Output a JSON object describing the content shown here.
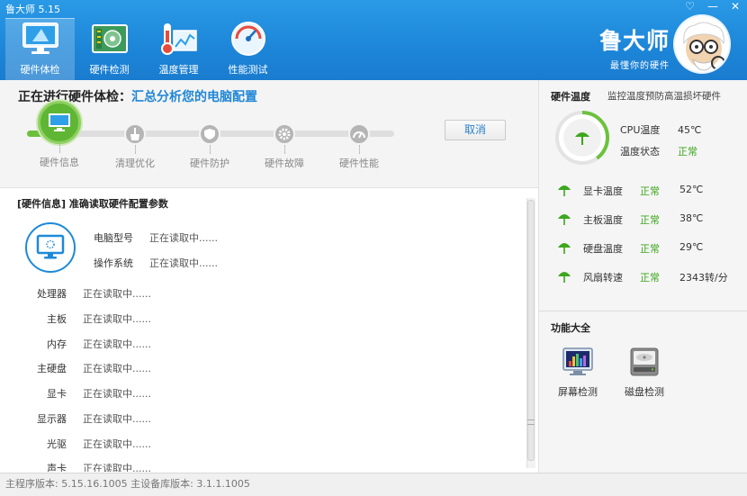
{
  "window": {
    "title": "鲁大师 5.15",
    "controls": [
      "♡",
      "—",
      "✕"
    ]
  },
  "nav": [
    {
      "label": "硬件体检",
      "icon": "monitor-icon",
      "active": true
    },
    {
      "label": "硬件检测",
      "icon": "board-icon",
      "active": false
    },
    {
      "label": "温度管理",
      "icon": "thermometer-icon",
      "active": false
    },
    {
      "label": "性能测试",
      "icon": "speedometer-icon",
      "active": false
    }
  ],
  "brand": {
    "name": "鲁大师",
    "slogan": "最懂你的硬件"
  },
  "check": {
    "title": "正在进行硬件体检：",
    "subtitle": "汇总分析您的电脑配置",
    "cancel_label": "取消",
    "steps": [
      "硬件信息",
      "清理优化",
      "硬件防护",
      "硬件故障",
      "硬件性能"
    ]
  },
  "hardware_info": {
    "header": "[硬件信息] 准确读取硬件配置参数",
    "top": [
      {
        "label": "电脑型号",
        "value": "正在读取中......"
      },
      {
        "label": "操作系统",
        "value": "正在读取中......"
      }
    ],
    "rows": [
      {
        "label": "处理器",
        "value": "正在读取中......"
      },
      {
        "label": "主板",
        "value": "正在读取中......"
      },
      {
        "label": "内存",
        "value": "正在读取中......"
      },
      {
        "label": "主硬盘",
        "value": "正在读取中......"
      },
      {
        "label": "显卡",
        "value": "正在读取中......"
      },
      {
        "label": "显示器",
        "value": "正在读取中......"
      },
      {
        "label": "光驱",
        "value": "正在读取中......"
      },
      {
        "label": "声卡",
        "value": "正在读取中......"
      }
    ]
  },
  "temperature": {
    "title": "硬件温度",
    "subtitle": "监控温度预防高温损坏硬件",
    "cpu_label": "CPU温度",
    "cpu_value": "45℃",
    "cpu_gauge_fraction": 0.4,
    "status_label": "温度状态",
    "status_value": "正常",
    "sensors": [
      {
        "name": "显卡温度",
        "status": "正常",
        "value": "52℃"
      },
      {
        "name": "主板温度",
        "status": "正常",
        "value": "38℃"
      },
      {
        "name": "硬盘温度",
        "status": "正常",
        "value": "29℃"
      },
      {
        "name": "风扇转速",
        "status": "正常",
        "value": "2343转/分"
      }
    ],
    "accent": "#3ca71c"
  },
  "functions": {
    "title": "功能大全",
    "items": [
      {
        "label": "屏幕检测",
        "icon": "screen-test-icon"
      },
      {
        "label": "磁盘检测",
        "icon": "disk-test-icon"
      }
    ]
  },
  "footer": {
    "text": "主程序版本: 5.15.16.1005   主设备库版本: 3.1.1.1005"
  },
  "colors": {
    "header": "#1d86d8",
    "accent_blue": "#1f86d6",
    "accent_green": "#5fb534"
  }
}
